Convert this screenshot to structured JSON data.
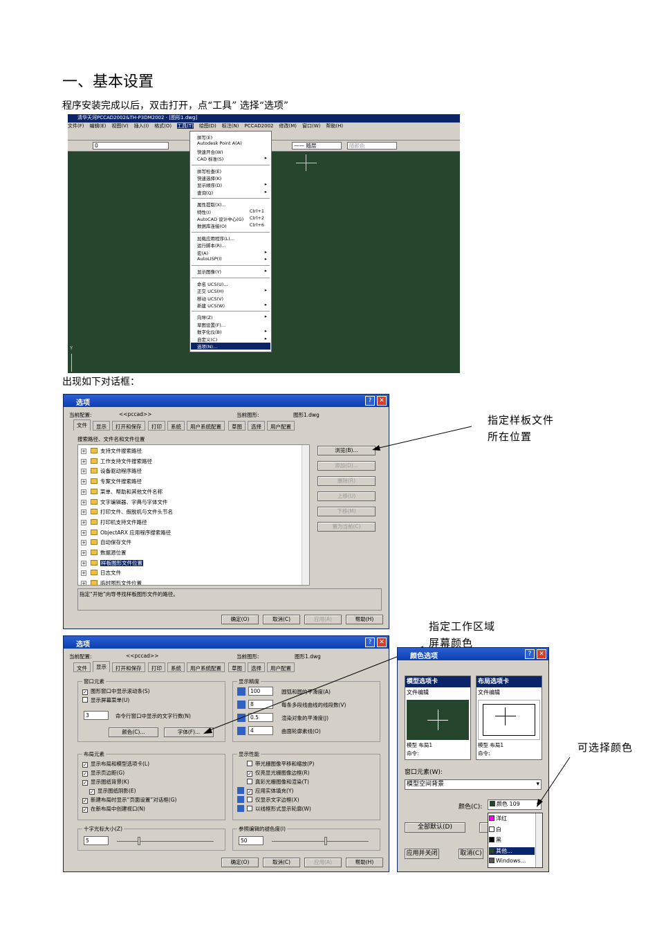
{
  "heading": "一、基本设置",
  "intro": "程序安装完成以后，双击打开，点“工具” 选择“选项”",
  "after_screenshot": "出现如下对话框：",
  "annotations": {
    "template": "指定样板文件所在位置",
    "screen_color": "指定工作区域屏幕颜色",
    "pick_color": "可选择颜色"
  },
  "cad": {
    "title": "清华天河PCCAD2002&TH-P3DM2002 - [图形1.dwg]",
    "menubar": [
      "文件(F)",
      "编辑(E)",
      "视图(V)",
      "插入(I)",
      "格式(O)",
      "工具(T)",
      "绘图(D)",
      "标注(N)",
      "PCCAD2002",
      "修改(M)",
      "窗口(W)",
      "帮助(H)"
    ],
    "layer": "0",
    "linetype": "—— 随层",
    "color": "随颜色",
    "tools_menu": [
      {
        "label": "拼写(E)"
      },
      {
        "label": "Autodesk Point A(A)"
      },
      {
        "label": "快速开合(W)"
      },
      {
        "label": "CAD 标准(S)",
        "sub": true
      },
      {
        "sep": true
      },
      {
        "label": "拼写检查(E)"
      },
      {
        "label": "快速选择(K)"
      },
      {
        "label": "显示顺序(D)",
        "sub": true
      },
      {
        "label": "查询(Q)",
        "sub": true
      },
      {
        "sep": true
      },
      {
        "label": "属性提取(X)..."
      },
      {
        "label": "特性(I)",
        "key": "Ctrl+1"
      },
      {
        "label": "AutoCAD 设计中心(G)",
        "key": "Ctrl+2"
      },
      {
        "label": "数据库连接(O)",
        "key": "Ctrl+6"
      },
      {
        "sep": true
      },
      {
        "label": "加载应用程序(L)..."
      },
      {
        "label": "运行脚本(R)..."
      },
      {
        "label": "宏(A)",
        "sub": true
      },
      {
        "label": "AutoLISP(I)",
        "sub": true
      },
      {
        "sep": true
      },
      {
        "label": "显示图像(Y)",
        "sub": true
      },
      {
        "sep": true
      },
      {
        "label": "命名 UCS(U)..."
      },
      {
        "label": "正交 UCS(H)",
        "sub": true
      },
      {
        "label": "移动 UCS(V)"
      },
      {
        "label": "新建 UCS(W)",
        "sub": true
      },
      {
        "sep": true
      },
      {
        "label": "向导(Z)",
        "sub": true
      },
      {
        "label": "草图设置(F)..."
      },
      {
        "label": "数字化仪(B)",
        "sub": true
      },
      {
        "label": "自定义(C)",
        "sub": true
      },
      {
        "label": "选项(N)...",
        "hl": true
      }
    ]
  },
  "options1": {
    "title": "选项",
    "profile_label": "当前配置:",
    "profile": "<<pccad>>",
    "drawing_label": "当前图形:",
    "drawing": "图形1.dwg",
    "tabs": [
      "文件",
      "显示",
      "打开和保存",
      "打印",
      "系统",
      "用户系统配置",
      "草图",
      "选择",
      "用户配置"
    ],
    "list_label": "搜索路径、文件名和文件位置",
    "items": [
      "支持文件搜索路径",
      "工作支持文件搜索路径",
      "设备驱动程序路径",
      "专案文件搜索路径",
      "菜单、帮助和其他文件名称",
      "文字编辑器、字典与字体文件",
      "打印文件、假脱机与文件头节名",
      "打印机支持文件路径",
      "ObjectARX 应用程序搜索路径",
      "自动保存文件",
      "数据源位置",
      "样板图形文件位置",
      "日志文件",
      "临时图形文件位置"
    ],
    "selected": "样板图形文件位置",
    "side_buttons": [
      "浏览(B)...",
      "添加(D)...",
      "删除(R)",
      "上移(U)",
      "下移(M)",
      "置为当前(C)"
    ],
    "hint": "指定“开始”向导寻找样板图形文件的路径。",
    "buttons": [
      "确定(O)",
      "取消(C)",
      "应用(A)",
      "帮助(H)"
    ]
  },
  "options2": {
    "title": "选项",
    "profile_label": "当前配置:",
    "profile": "<<pccad>>",
    "drawing_label": "当前图形:",
    "drawing": "图形1.dwg",
    "tabs": [
      "文件",
      "显示",
      "打开和保存",
      "打印",
      "系统",
      "用户系统配置",
      "草图",
      "选择",
      "用户配置"
    ],
    "window_group": "窗口元素",
    "window_items": [
      "图形窗口中显示滚动条(S)",
      "显示屏幕菜单(U)"
    ],
    "cmd_lines": "3",
    "cmd_label": "命令行窗口中显示的文字行数(N)",
    "color_btn": "颜色(C)...",
    "font_btn": "字体(F)...",
    "precision_group": "显示精度",
    "precision": [
      {
        "v": "100",
        "l": "圆弧和圆的平滑度(A)"
      },
      {
        "v": "8",
        "l": "每条多段线曲线的线段数(V)"
      },
      {
        "v": "0.5",
        "l": "渲染对象的平滑度(J)"
      },
      {
        "v": "4",
        "l": "曲面轮廓素线(O)"
      }
    ],
    "layout_group": "布局元素",
    "layout_items": [
      "显示布局和模型选项卡(L)",
      "显示页边距(G)",
      "显示图纸背景(K)",
      "显示图纸阴影(E)",
      "新建布局时显示“页面设置”对话框(G)",
      "在新布局中创建视口(N)"
    ],
    "perf_group": "显示性能",
    "perf_items": [
      "带光栅图像平移和缩放(P)",
      "仅亮显光栅图像边框(R)",
      "真彩光栅图像和渲染(T)",
      "应用实体填充(Y)",
      "仅显示文字边框(X)",
      "以线框形式显示轮廓(W)"
    ],
    "cross_group": "十字光标大小(Z)",
    "cross": "5",
    "fade_group": "参照编辑的褪色度(I)",
    "fade": "50",
    "buttons": [
      "确定(O)",
      "取消(C)",
      "应用(A)",
      "帮助(H)"
    ]
  },
  "color_dialog": {
    "title": "颜色选项",
    "model_tab": "模型选项卡",
    "layout_tab": "布局选项卡",
    "model_sub": "文件编辑",
    "layout_sub": "文件编辑",
    "model_status": "模型 布局1",
    "layout_status": "模型 布局1",
    "cmd": "命令:",
    "element_label": "窗口元素(W):",
    "element": "模型空间背景",
    "color_label": "颜色(C):",
    "color": "颜色 109",
    "default_btn": "全部默认(D)",
    "apply_btn": "应用并关闭",
    "cancel_btn": "取消(C)",
    "options": [
      {
        "name": "洋红",
        "c": "#ff00ff"
      },
      {
        "name": "白",
        "c": "#ffffff"
      },
      {
        "name": "黑",
        "c": "#000000"
      },
      {
        "name": "其他...",
        "c": "#25462d"
      },
      {
        "name": "Windows...",
        "c": "#555555"
      }
    ]
  }
}
